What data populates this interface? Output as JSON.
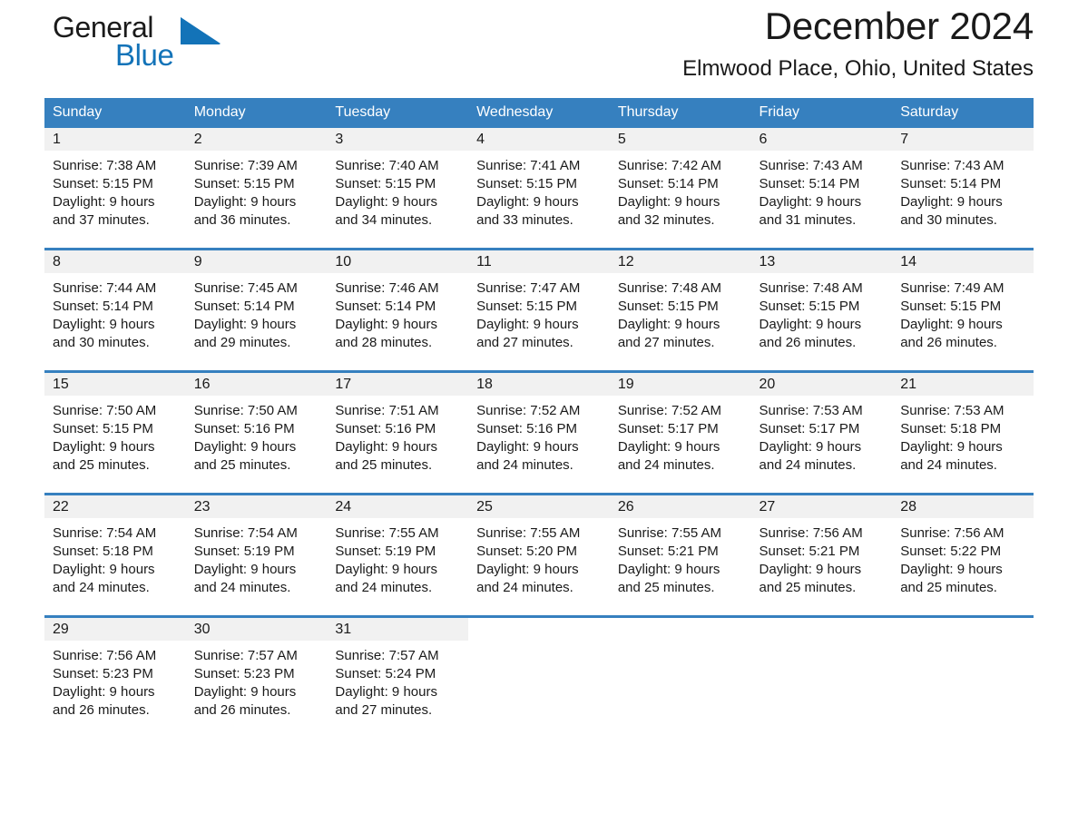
{
  "brand": {
    "word1": "General",
    "word2": "Blue",
    "triangle_icon": "brand-triangle-icon",
    "accent_color": "#1373b8"
  },
  "header": {
    "month_title": "December 2024",
    "location": "Elmwood Place, Ohio, United States"
  },
  "theme": {
    "header_blue": "#3680bf",
    "daynum_band": "#f1f1f1",
    "text": "#1a1a1a",
    "page_background": "#ffffff"
  },
  "calendar": {
    "day_headers": [
      "Sunday",
      "Monday",
      "Tuesday",
      "Wednesday",
      "Thursday",
      "Friday",
      "Saturday"
    ],
    "weeks": [
      [
        {
          "day": "1",
          "sunrise": "Sunrise: 7:38 AM",
          "sunset": "Sunset: 5:15 PM",
          "daylight1": "Daylight: 9 hours",
          "daylight2": "and 37 minutes."
        },
        {
          "day": "2",
          "sunrise": "Sunrise: 7:39 AM",
          "sunset": "Sunset: 5:15 PM",
          "daylight1": "Daylight: 9 hours",
          "daylight2": "and 36 minutes."
        },
        {
          "day": "3",
          "sunrise": "Sunrise: 7:40 AM",
          "sunset": "Sunset: 5:15 PM",
          "daylight1": "Daylight: 9 hours",
          "daylight2": "and 34 minutes."
        },
        {
          "day": "4",
          "sunrise": "Sunrise: 7:41 AM",
          "sunset": "Sunset: 5:15 PM",
          "daylight1": "Daylight: 9 hours",
          "daylight2": "and 33 minutes."
        },
        {
          "day": "5",
          "sunrise": "Sunrise: 7:42 AM",
          "sunset": "Sunset: 5:14 PM",
          "daylight1": "Daylight: 9 hours",
          "daylight2": "and 32 minutes."
        },
        {
          "day": "6",
          "sunrise": "Sunrise: 7:43 AM",
          "sunset": "Sunset: 5:14 PM",
          "daylight1": "Daylight: 9 hours",
          "daylight2": "and 31 minutes."
        },
        {
          "day": "7",
          "sunrise": "Sunrise: 7:43 AM",
          "sunset": "Sunset: 5:14 PM",
          "daylight1": "Daylight: 9 hours",
          "daylight2": "and 30 minutes."
        }
      ],
      [
        {
          "day": "8",
          "sunrise": "Sunrise: 7:44 AM",
          "sunset": "Sunset: 5:14 PM",
          "daylight1": "Daylight: 9 hours",
          "daylight2": "and 30 minutes."
        },
        {
          "day": "9",
          "sunrise": "Sunrise: 7:45 AM",
          "sunset": "Sunset: 5:14 PM",
          "daylight1": "Daylight: 9 hours",
          "daylight2": "and 29 minutes."
        },
        {
          "day": "10",
          "sunrise": "Sunrise: 7:46 AM",
          "sunset": "Sunset: 5:14 PM",
          "daylight1": "Daylight: 9 hours",
          "daylight2": "and 28 minutes."
        },
        {
          "day": "11",
          "sunrise": "Sunrise: 7:47 AM",
          "sunset": "Sunset: 5:15 PM",
          "daylight1": "Daylight: 9 hours",
          "daylight2": "and 27 minutes."
        },
        {
          "day": "12",
          "sunrise": "Sunrise: 7:48 AM",
          "sunset": "Sunset: 5:15 PM",
          "daylight1": "Daylight: 9 hours",
          "daylight2": "and 27 minutes."
        },
        {
          "day": "13",
          "sunrise": "Sunrise: 7:48 AM",
          "sunset": "Sunset: 5:15 PM",
          "daylight1": "Daylight: 9 hours",
          "daylight2": "and 26 minutes."
        },
        {
          "day": "14",
          "sunrise": "Sunrise: 7:49 AM",
          "sunset": "Sunset: 5:15 PM",
          "daylight1": "Daylight: 9 hours",
          "daylight2": "and 26 minutes."
        }
      ],
      [
        {
          "day": "15",
          "sunrise": "Sunrise: 7:50 AM",
          "sunset": "Sunset: 5:15 PM",
          "daylight1": "Daylight: 9 hours",
          "daylight2": "and 25 minutes."
        },
        {
          "day": "16",
          "sunrise": "Sunrise: 7:50 AM",
          "sunset": "Sunset: 5:16 PM",
          "daylight1": "Daylight: 9 hours",
          "daylight2": "and 25 minutes."
        },
        {
          "day": "17",
          "sunrise": "Sunrise: 7:51 AM",
          "sunset": "Sunset: 5:16 PM",
          "daylight1": "Daylight: 9 hours",
          "daylight2": "and 25 minutes."
        },
        {
          "day": "18",
          "sunrise": "Sunrise: 7:52 AM",
          "sunset": "Sunset: 5:16 PM",
          "daylight1": "Daylight: 9 hours",
          "daylight2": "and 24 minutes."
        },
        {
          "day": "19",
          "sunrise": "Sunrise: 7:52 AM",
          "sunset": "Sunset: 5:17 PM",
          "daylight1": "Daylight: 9 hours",
          "daylight2": "and 24 minutes."
        },
        {
          "day": "20",
          "sunrise": "Sunrise: 7:53 AM",
          "sunset": "Sunset: 5:17 PM",
          "daylight1": "Daylight: 9 hours",
          "daylight2": "and 24 minutes."
        },
        {
          "day": "21",
          "sunrise": "Sunrise: 7:53 AM",
          "sunset": "Sunset: 5:18 PM",
          "daylight1": "Daylight: 9 hours",
          "daylight2": "and 24 minutes."
        }
      ],
      [
        {
          "day": "22",
          "sunrise": "Sunrise: 7:54 AM",
          "sunset": "Sunset: 5:18 PM",
          "daylight1": "Daylight: 9 hours",
          "daylight2": "and 24 minutes."
        },
        {
          "day": "23",
          "sunrise": "Sunrise: 7:54 AM",
          "sunset": "Sunset: 5:19 PM",
          "daylight1": "Daylight: 9 hours",
          "daylight2": "and 24 minutes."
        },
        {
          "day": "24",
          "sunrise": "Sunrise: 7:55 AM",
          "sunset": "Sunset: 5:19 PM",
          "daylight1": "Daylight: 9 hours",
          "daylight2": "and 24 minutes."
        },
        {
          "day": "25",
          "sunrise": "Sunrise: 7:55 AM",
          "sunset": "Sunset: 5:20 PM",
          "daylight1": "Daylight: 9 hours",
          "daylight2": "and 24 minutes."
        },
        {
          "day": "26",
          "sunrise": "Sunrise: 7:55 AM",
          "sunset": "Sunset: 5:21 PM",
          "daylight1": "Daylight: 9 hours",
          "daylight2": "and 25 minutes."
        },
        {
          "day": "27",
          "sunrise": "Sunrise: 7:56 AM",
          "sunset": "Sunset: 5:21 PM",
          "daylight1": "Daylight: 9 hours",
          "daylight2": "and 25 minutes."
        },
        {
          "day": "28",
          "sunrise": "Sunrise: 7:56 AM",
          "sunset": "Sunset: 5:22 PM",
          "daylight1": "Daylight: 9 hours",
          "daylight2": "and 25 minutes."
        }
      ],
      [
        {
          "day": "29",
          "sunrise": "Sunrise: 7:56 AM",
          "sunset": "Sunset: 5:23 PM",
          "daylight1": "Daylight: 9 hours",
          "daylight2": "and 26 minutes."
        },
        {
          "day": "30",
          "sunrise": "Sunrise: 7:57 AM",
          "sunset": "Sunset: 5:23 PM",
          "daylight1": "Daylight: 9 hours",
          "daylight2": "and 26 minutes."
        },
        {
          "day": "31",
          "sunrise": "Sunrise: 7:57 AM",
          "sunset": "Sunset: 5:24 PM",
          "daylight1": "Daylight: 9 hours",
          "daylight2": "and 27 minutes."
        },
        {
          "day": "",
          "sunrise": "",
          "sunset": "",
          "daylight1": "",
          "daylight2": ""
        },
        {
          "day": "",
          "sunrise": "",
          "sunset": "",
          "daylight1": "",
          "daylight2": ""
        },
        {
          "day": "",
          "sunrise": "",
          "sunset": "",
          "daylight1": "",
          "daylight2": ""
        },
        {
          "day": "",
          "sunrise": "",
          "sunset": "",
          "daylight1": "",
          "daylight2": ""
        }
      ]
    ]
  }
}
